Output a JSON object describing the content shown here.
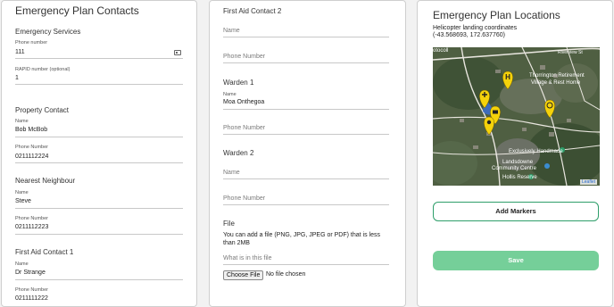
{
  "left": {
    "title": "Emergency Plan Contacts",
    "emergency": {
      "heading": "Emergency Services",
      "phone_label": "Phone number",
      "phone_value": "111",
      "rapid_label": "RAPID number (optional)",
      "rapid_value": "1"
    },
    "property": {
      "heading": "Property Contact",
      "name_label": "Name",
      "name_value": "Bob McBob",
      "phone_label": "Phone Number",
      "phone_value": "0211112224"
    },
    "neighbour": {
      "heading": "Nearest Neighbour",
      "name_label": "Name",
      "name_value": "Steve",
      "phone_label": "Phone Number",
      "phone_value": "0211112223"
    },
    "firstaid1": {
      "heading": "First Aid Contact 1",
      "name_label": "Name",
      "name_value": "Dr Strange",
      "phone_label": "Phone Number",
      "phone_value": "0211111222"
    }
  },
  "middle": {
    "firstaid2": {
      "heading": "First Aid Contact 2",
      "name_placeholder": "Name",
      "phone_placeholder": "Phone Number"
    },
    "warden1": {
      "heading": "Warden 1",
      "name_label": "Name",
      "name_value": "Moa Onthegoa",
      "phone_placeholder": "Phone Number"
    },
    "warden2": {
      "heading": "Warden 2",
      "name_placeholder": "Name",
      "phone_placeholder": "Phone Number"
    },
    "file": {
      "heading": "File",
      "help_line1": "You can add a file (PNG, JPG, JPEG or PDF) that is less",
      "help_line2": "than 2MB",
      "desc_placeholder": "What is in this file",
      "choose_label": "Choose File",
      "status": "No file chosen"
    }
  },
  "right": {
    "title": "Emergency Plan Locations",
    "heli_label": "Helicopter landing coordinates",
    "heli_coords": "(-43.568693, 172.637760)",
    "map_labels": {
      "retirement_1": "Thorrington Retirement",
      "retirement_2": "Village & Rest Home",
      "handmade": "Exclusively Handmade",
      "landsdowne_1": "Landsdowne",
      "landsdowne_2": "Community Centre",
      "reserve": "Hollis Reserve",
      "road": "Riverview St",
      "corner": "otocoll",
      "credit": "Leaflet"
    },
    "add_markers": "Add Markers",
    "save": "Save",
    "colors": {
      "accent": "#2e9e6a",
      "save_bg": "#75cf99",
      "marker": "#f5d20b"
    }
  }
}
